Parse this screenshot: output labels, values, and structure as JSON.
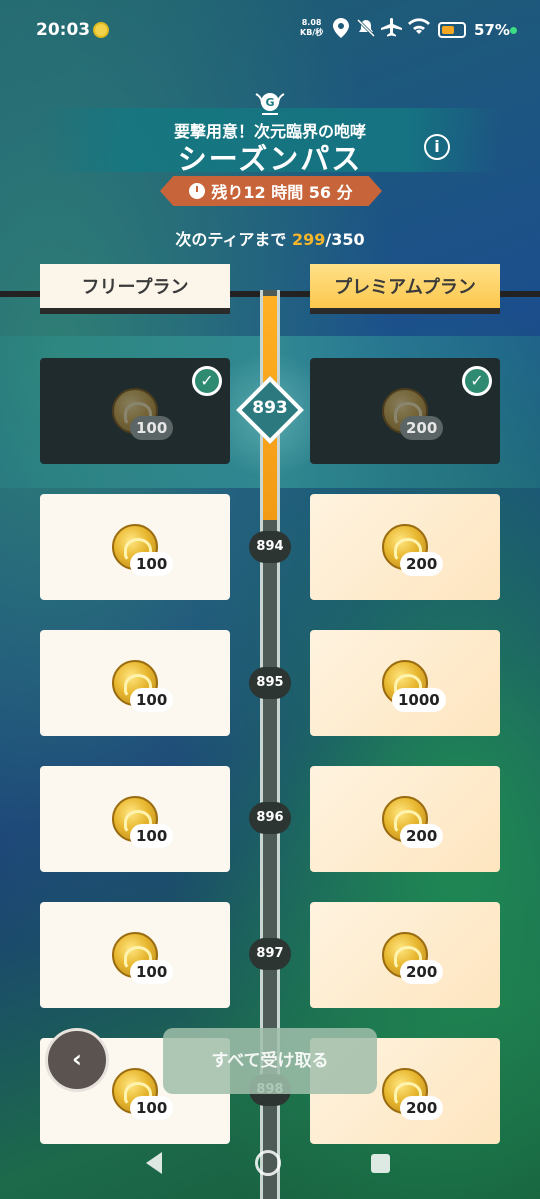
{
  "status_bar": {
    "time": "20:03",
    "speed_value": "8.08",
    "speed_unit": "KB/秒",
    "battery_percent": "57%",
    "icons": [
      "notification-coin-icon",
      "location-icon",
      "mute-icon",
      "airplane-icon",
      "wifi-icon",
      "battery-icon"
    ]
  },
  "header": {
    "subtitle": "要撃用意！次元臨界の咆哮",
    "title": "シーズンパス",
    "info_label": "i",
    "timer_text": "残り12 時間 56 分",
    "next_tier_label": "次のティアまで ",
    "next_tier_current": "299",
    "next_tier_total": "/350"
  },
  "plans": {
    "free_label": "フリープラン",
    "premium_label": "プレミアムプラン"
  },
  "tiers": [
    {
      "level": "893",
      "free_amount": "100",
      "premium_amount": "200",
      "claimed": true,
      "current": true
    },
    {
      "level": "894",
      "free_amount": "100",
      "premium_amount": "200",
      "claimed": false
    },
    {
      "level": "895",
      "free_amount": "100",
      "premium_amount": "1000",
      "claimed": false
    },
    {
      "level": "896",
      "free_amount": "100",
      "premium_amount": "200",
      "claimed": false
    },
    {
      "level": "897",
      "free_amount": "100",
      "premium_amount": "200",
      "claimed": false
    },
    {
      "level": "898",
      "free_amount": "100",
      "premium_amount": "200",
      "claimed": false
    }
  ],
  "controls": {
    "back_label": "‹",
    "claim_all_label": "すべて受け取る"
  },
  "colors": {
    "accent_orange": "#f29a14",
    "timer_bg": "#c8643a",
    "premium_tab": "#fbc74d",
    "claimed_check": "#2f8a72"
  }
}
